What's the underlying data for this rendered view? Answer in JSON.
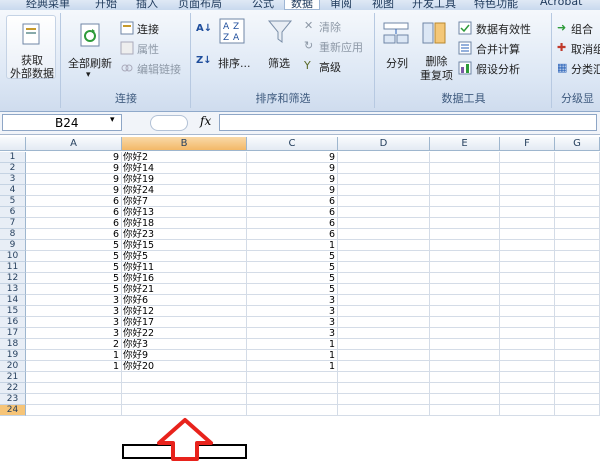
{
  "tabs": [
    "经典菜单",
    "开始",
    "插入",
    "页面布局",
    "公式",
    "数据",
    "审阅",
    "视图",
    "开发工具",
    "特色功能",
    "Acrobat"
  ],
  "ribbon": {
    "get_external": "获取\n外部数据",
    "connections_group": {
      "refresh_all": "全部刷新",
      "connections": "连接",
      "properties": "属性",
      "edit_links": "编辑链接",
      "label": "连接"
    },
    "sort_group": {
      "sort": "排序...",
      "filter": "筛选",
      "clear": "清除",
      "reapply": "重新应用",
      "advanced": "高级",
      "label": "排序和筛选"
    },
    "tools_group": {
      "split": "分列",
      "remove_dup": "删除\n重复项",
      "validation": "数据有效性",
      "consolidate": "合并计算",
      "whatif": "假设分析",
      "label": "数据工具"
    },
    "outline_group": {
      "group": "组合",
      "ungroup": "取消组",
      "subtotal": "分类汇",
      "label": "分级显"
    }
  },
  "formula_bar": {
    "name_box": "B24",
    "fx": "fx",
    "value": ""
  },
  "columns": [
    "A",
    "B",
    "C",
    "D",
    "E",
    "F",
    "G"
  ],
  "rows": [
    {
      "n": "1",
      "a": "9",
      "b": "你好2",
      "c": "9"
    },
    {
      "n": "2",
      "a": "9",
      "b": "你好14",
      "c": "9"
    },
    {
      "n": "3",
      "a": "9",
      "b": "你好19",
      "c": "9"
    },
    {
      "n": "4",
      "a": "9",
      "b": "你好24",
      "c": "9"
    },
    {
      "n": "5",
      "a": "6",
      "b": "你好7",
      "c": "6"
    },
    {
      "n": "6",
      "a": "6",
      "b": "你好13",
      "c": "6"
    },
    {
      "n": "7",
      "a": "6",
      "b": "你好18",
      "c": "6"
    },
    {
      "n": "8",
      "a": "6",
      "b": "你好23",
      "c": "6"
    },
    {
      "n": "9",
      "a": "5",
      "b": "你好15",
      "c": "1"
    },
    {
      "n": "10",
      "a": "5",
      "b": "你好5",
      "c": "5"
    },
    {
      "n": "11",
      "a": "5",
      "b": "你好11",
      "c": "5"
    },
    {
      "n": "12",
      "a": "5",
      "b": "你好16",
      "c": "5"
    },
    {
      "n": "13",
      "a": "5",
      "b": "你好21",
      "c": "5"
    },
    {
      "n": "14",
      "a": "3",
      "b": "你好6",
      "c": "3"
    },
    {
      "n": "15",
      "a": "3",
      "b": "你好12",
      "c": "3"
    },
    {
      "n": "16",
      "a": "3",
      "b": "你好17",
      "c": "3"
    },
    {
      "n": "17",
      "a": "3",
      "b": "你好22",
      "c": "3"
    },
    {
      "n": "18",
      "a": "2",
      "b": "你好3",
      "c": "1"
    },
    {
      "n": "19",
      "a": "1",
      "b": "你好9",
      "c": "1"
    },
    {
      "n": "20",
      "a": "1",
      "b": "你好20",
      "c": "1"
    },
    {
      "n": "21",
      "a": "",
      "b": "",
      "c": ""
    },
    {
      "n": "22",
      "a": "",
      "b": "",
      "c": ""
    },
    {
      "n": "23",
      "a": "",
      "b": "",
      "c": ""
    },
    {
      "n": "24",
      "a": "",
      "b": "",
      "c": ""
    }
  ],
  "selected_cell": "B24",
  "annotation": {
    "icon": "up-arrow-icon",
    "color": "#e8231c"
  }
}
